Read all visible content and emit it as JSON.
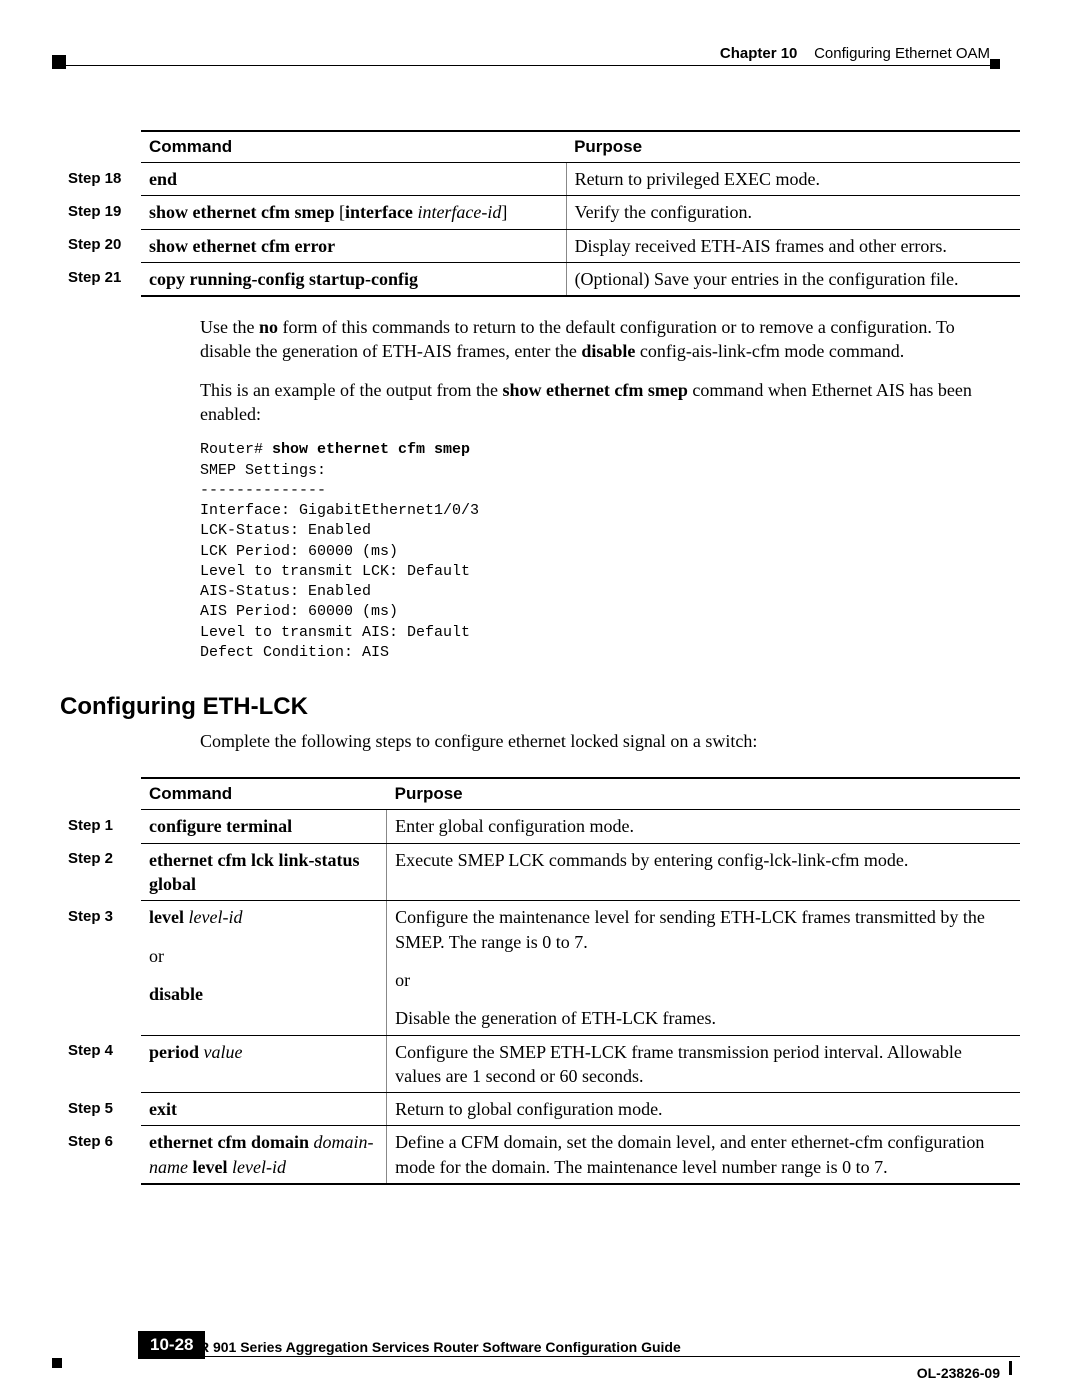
{
  "header": {
    "chapter_label": "Chapter 10",
    "chapter_title": "Configuring Ethernet OAM"
  },
  "table1": {
    "col_command": "Command",
    "col_purpose": "Purpose",
    "rows": [
      {
        "step": "Step 18",
        "cmd_parts": [
          "end"
        ],
        "purpose": "Return to privileged EXEC mode."
      },
      {
        "step": "Step 19",
        "cmd_parts": [
          "show ethernet cfm smep",
          " [",
          "interface",
          " ",
          "interface-id",
          "]"
        ],
        "purpose": "Verify the configuration."
      },
      {
        "step": "Step 20",
        "cmd_parts": [
          "show ethernet cfm error"
        ],
        "purpose": "Display received ETH-AIS frames and other errors."
      },
      {
        "step": "Step 21",
        "cmd_parts": [
          "copy running-config startup-config"
        ],
        "purpose": "(Optional) Save your entries in the configuration file."
      }
    ]
  },
  "para1_a": "Use the ",
  "para1_no": "no",
  "para1_b": " form of this commands to return to the default configuration or to remove a configuration. To disable the generation of ETH-AIS frames, enter the ",
  "para1_disable": "disable",
  "para1_c": " config-ais-link-cfm mode command.",
  "para2_a": "This is an example of the output from the ",
  "para2_cmd": "show ethernet cfm smep",
  "para2_b": " command when Ethernet AIS has been enabled:",
  "code_prompt": "Router# ",
  "code_cmd": "show ethernet cfm smep",
  "code_body": "SMEP Settings:\n--------------\nInterface: GigabitEthernet1/0/3\nLCK-Status: Enabled\nLCK Period: 60000 (ms)\nLevel to transmit LCK: Default\nAIS-Status: Enabled\nAIS Period: 60000 (ms)\nLevel to transmit AIS: Default\nDefect Condition: AIS",
  "section_heading": "Configuring ETH-LCK",
  "section_intro": "Complete the following steps to configure ethernet locked signal on a switch:",
  "table2": {
    "col_command": "Command",
    "col_purpose": "Purpose",
    "rows": [
      {
        "step": "Step 1",
        "cmd": {
          "segments": [
            {
              "t": "configure terminal",
              "b": true
            }
          ]
        },
        "purpose_segments": [
          {
            "t": "Enter global configuration mode."
          }
        ]
      },
      {
        "step": "Step 2",
        "cmd": {
          "segments": [
            {
              "t": "ethernet cfm lck link-status global",
              "b": true
            }
          ]
        },
        "purpose_segments": [
          {
            "t": "Execute SMEP LCK commands by entering config-lck-link-cfm mode."
          }
        ]
      },
      {
        "step": "Step 3",
        "cmd": {
          "blocks": [
            {
              "segments": [
                {
                  "t": "level ",
                  "b": true
                },
                {
                  "t": "level-id",
                  "i": true
                }
              ]
            },
            {
              "plain": "or"
            },
            {
              "segments": [
                {
                  "t": "disable",
                  "b": true
                }
              ]
            }
          ]
        },
        "purpose_blocks": [
          "Configure the maintenance level for sending ETH-LCK frames transmitted by the SMEP. The range is 0 to 7.",
          "or",
          "Disable the generation of ETH-LCK frames."
        ]
      },
      {
        "step": "Step 4",
        "cmd": {
          "segments": [
            {
              "t": "period ",
              "b": true
            },
            {
              "t": "value",
              "i": true
            }
          ]
        },
        "purpose_segments": [
          {
            "t": "Configure the SMEP ETH-LCK frame transmission period interval. Allowable values are 1 second or 60 seconds."
          }
        ]
      },
      {
        "step": "Step 5",
        "cmd": {
          "segments": [
            {
              "t": "exit",
              "b": true
            }
          ]
        },
        "purpose_segments": [
          {
            "t": "Return to global configuration mode."
          }
        ]
      },
      {
        "step": "Step 6",
        "cmd": {
          "segments": [
            {
              "t": "ethernet cfm domain ",
              "b": true
            },
            {
              "t": "domain-name",
              "i": true
            },
            {
              "t": " level ",
              "b": true
            },
            {
              "t": "level-id",
              "i": true
            }
          ]
        },
        "purpose_segments": [
          {
            "t": "Define a CFM domain, set the domain level, and enter ethernet-cfm configuration mode for the domain. The maintenance level number range is 0 to 7."
          }
        ]
      }
    ]
  },
  "footer": {
    "book_title": "Cisco ASR 901 Series Aggregation Services Router Software Configuration Guide",
    "page_number": "10-28",
    "doc_id": "OL-23826-09"
  }
}
